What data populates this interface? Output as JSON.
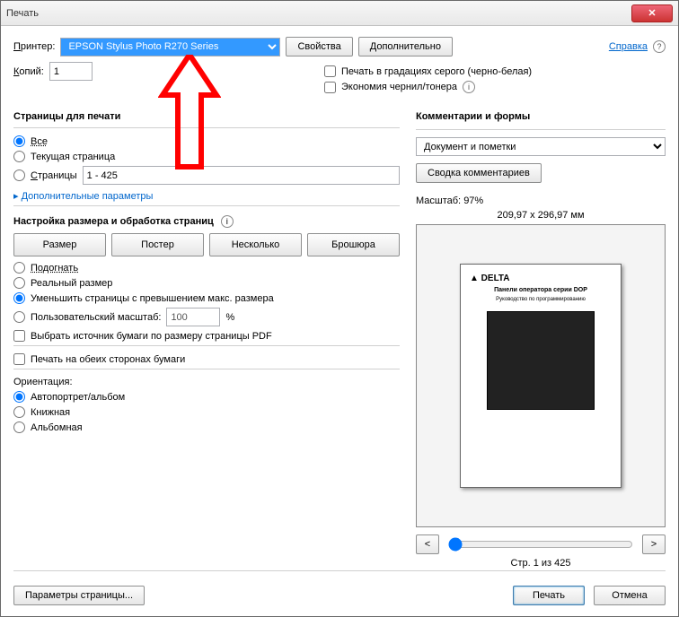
{
  "window": {
    "title": "Печать"
  },
  "header": {
    "printer_label": "Принтер:",
    "printer_value": "EPSON Stylus Photo R270 Series",
    "properties_btn": "Свойства",
    "advanced_btn": "Дополнительно",
    "help_link": "Справка",
    "copies_label": "Копий:",
    "copies_value": "1",
    "grayscale_label": "Печать в градациях серого (черно-белая)",
    "economy_label": "Экономия чернил/тонера"
  },
  "pages": {
    "section": "Страницы для печати",
    "all": "Все",
    "current": "Текущая страница",
    "range_label": "Страницы",
    "range_value": "1 - 425",
    "more": "Дополнительные параметры"
  },
  "sizing": {
    "section": "Настройка размера и обработка страниц",
    "tab_size": "Размер",
    "tab_poster": "Постер",
    "tab_multi": "Несколько",
    "tab_booklet": "Брошюра",
    "fit": "Подогнать",
    "actual": "Реальный размер",
    "shrink": "Уменьшить страницы с превышением макс. размера",
    "custom_label": "Пользовательский масштаб:",
    "custom_value": "100",
    "percent": "%",
    "choose_source": "Выбрать источник бумаги по размеру страницы PDF",
    "duplex": "Печать на обеих сторонах бумаги",
    "orient_label": "Ориентация:",
    "orient_auto": "Автопортрет/альбом",
    "orient_portrait": "Книжная",
    "orient_landscape": "Альбомная"
  },
  "comments": {
    "section": "Комментарии и формы",
    "value": "Документ и пометки",
    "summary_btn": "Сводка комментариев"
  },
  "preview": {
    "scale_label": "Масштаб:",
    "scale_value": "97%",
    "dims": "209,97 x 296,97 мм",
    "doc_logo": "▲ DELTA",
    "doc_line1": "Панели оператора серии DOP",
    "doc_line2": "Руководство по программированию",
    "page_info": "Стр. 1 из 425",
    "prev": "<",
    "next": ">"
  },
  "footer": {
    "page_setup": "Параметры страницы...",
    "print": "Печать",
    "cancel": "Отмена"
  }
}
